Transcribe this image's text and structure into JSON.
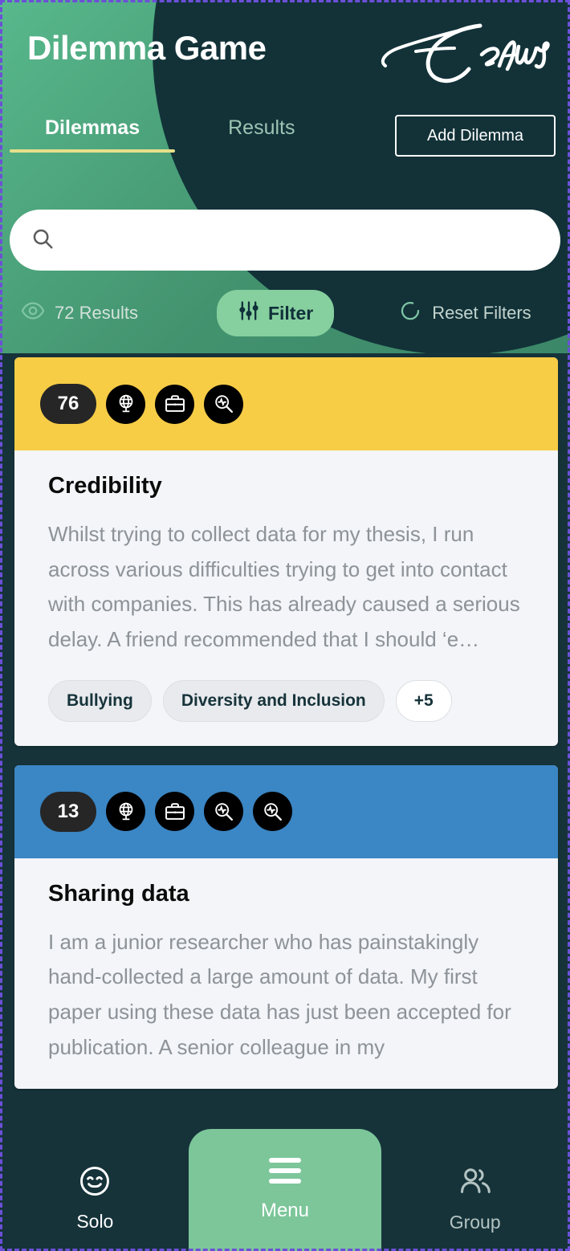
{
  "app": {
    "title": "Dilemma Game",
    "logo_alt": "Erasmus University signature logo"
  },
  "header": {
    "tabs": [
      {
        "label": "Dilemmas",
        "active": true
      },
      {
        "label": "Results",
        "active": false
      }
    ],
    "add_dilemma_label": "Add Dilemma"
  },
  "search": {
    "value": "",
    "placeholder": "",
    "icon": "search-icon"
  },
  "filter_bar": {
    "results_label": "72 Results",
    "results_count": 72,
    "results_icon": "eye-icon",
    "filter_label": "Filter",
    "filter_icon": "sliders-icon",
    "reset_label": "Reset Filters",
    "reset_icon": "refresh-icon"
  },
  "cards": [
    {
      "accent_color": "#f7cd46",
      "badge": "76",
      "icons": [
        "globe-icon",
        "briefcase-icon",
        "magnifier-pulse-icon"
      ],
      "title": "Credibility",
      "text": "Whilst trying to collect data for my thesis, I run across various difficulties trying to get into contact with companies. This has already caused a serious delay. A friend recommended that I should ‘e…",
      "tags": [
        "Bullying",
        "Diversity and Inclusion"
      ],
      "more_tags_label": "+5"
    },
    {
      "accent_color": "#3b86c4",
      "badge": "13",
      "icons": [
        "globe-icon",
        "briefcase-icon",
        "magnifier-pulse-icon",
        "magnifier-pulse-icon"
      ],
      "title": "Sharing data",
      "text": "I am a junior researcher who has painstakingly hand-collected a large amount of data. My first paper using these data has just been accepted for publication. A senior colleague in my",
      "tags": [],
      "more_tags_label": ""
    }
  ],
  "bottom_nav": {
    "solo": {
      "label": "Solo",
      "icon": "smiley-icon"
    },
    "menu": {
      "label": "Menu",
      "icon": "hamburger-icon"
    },
    "group": {
      "label": "Group",
      "icon": "group-people-icon"
    }
  },
  "colors": {
    "header_green": "#43936f",
    "dark_navy": "#16333a",
    "accent_yellow": "#f7cd46",
    "accent_blue": "#3b86c4",
    "filter_green": "#86cf9e",
    "tab_underline": "#e6e08b",
    "menu_green": "#7cc69a"
  }
}
